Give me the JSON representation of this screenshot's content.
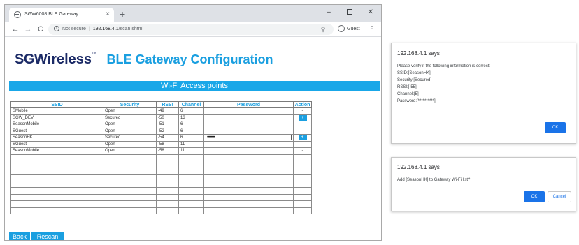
{
  "browser": {
    "tab_title": "SGW6008 BLE Gateway",
    "tab_close": "×",
    "new_tab": "+",
    "window_controls": {
      "minimize": "–",
      "close": "✕"
    },
    "nav": {
      "back": "←",
      "forward": "→",
      "reload": "C"
    },
    "omnibox": {
      "security_label": "Not secure",
      "url_host": "192.168.4.1",
      "url_path": "/scan.shtml"
    },
    "profile_label": "Guest",
    "menu": "⋮",
    "icons": [
      "globe-icon",
      "info-icon",
      "zoom-icon",
      "profile-icon",
      "kebab-menu-icon"
    ]
  },
  "page": {
    "brand": {
      "sg": "SG",
      "wireless": "Wireless",
      "tm": "™"
    },
    "title": "BLE Gateway Configuration",
    "section_title": "Wi-Fi Access points",
    "table": {
      "headers": [
        "SSID",
        "Security",
        "RSSI",
        "Channel",
        "Password",
        "Action"
      ],
      "rows": [
        {
          "ssid": "SMobile",
          "security": "Open",
          "rssi": "-49",
          "channel": "6",
          "password": "",
          "action": "-"
        },
        {
          "ssid": "SGW_DEV",
          "security": "Secured",
          "rssi": "-50",
          "channel": "13",
          "password": "",
          "action": "+"
        },
        {
          "ssid": "SeasonMobile",
          "security": "Open",
          "rssi": "-51",
          "channel": "6",
          "password": "",
          "action": "-"
        },
        {
          "ssid": "SGuest",
          "security": "Open",
          "rssi": "-52",
          "channel": "6",
          "password": "",
          "action": "-"
        },
        {
          "ssid": "SeasonHK",
          "security": "Secured",
          "rssi": "-54",
          "channel": "6",
          "password": "••••••••••",
          "action": "+"
        },
        {
          "ssid": "SGuest",
          "security": "Open",
          "rssi": "-58",
          "channel": "11",
          "password": "",
          "action": "-"
        },
        {
          "ssid": "SeasonMobile",
          "security": "Open",
          "rssi": "-58",
          "channel": "11",
          "password": "",
          "action": "-"
        }
      ],
      "empty_rows": 9
    },
    "buttons": {
      "back": "Back",
      "rescan": "Rescan"
    }
  },
  "dialog_confirm": {
    "title": "192.168.4.1 says",
    "lines": [
      "Please verify if the following information is correct:",
      "SSID:[SeasonHK]",
      "Security:[Secured]",
      "RSSI:[-55]",
      "Channel:[5]",
      "Password:[**********]"
    ],
    "ok": "OK"
  },
  "dialog_add": {
    "title": "192.168.4.1 says",
    "message": "Add [SeasonHK] to Gateway Wi-Fi list?",
    "ok": "OK",
    "cancel": "Cancel"
  },
  "colors": {
    "brand_navy": "#1b2a66",
    "accent_blue": "#1a9fe0",
    "section_bar": "#19a7e8",
    "dialog_button": "#1a73e8"
  }
}
